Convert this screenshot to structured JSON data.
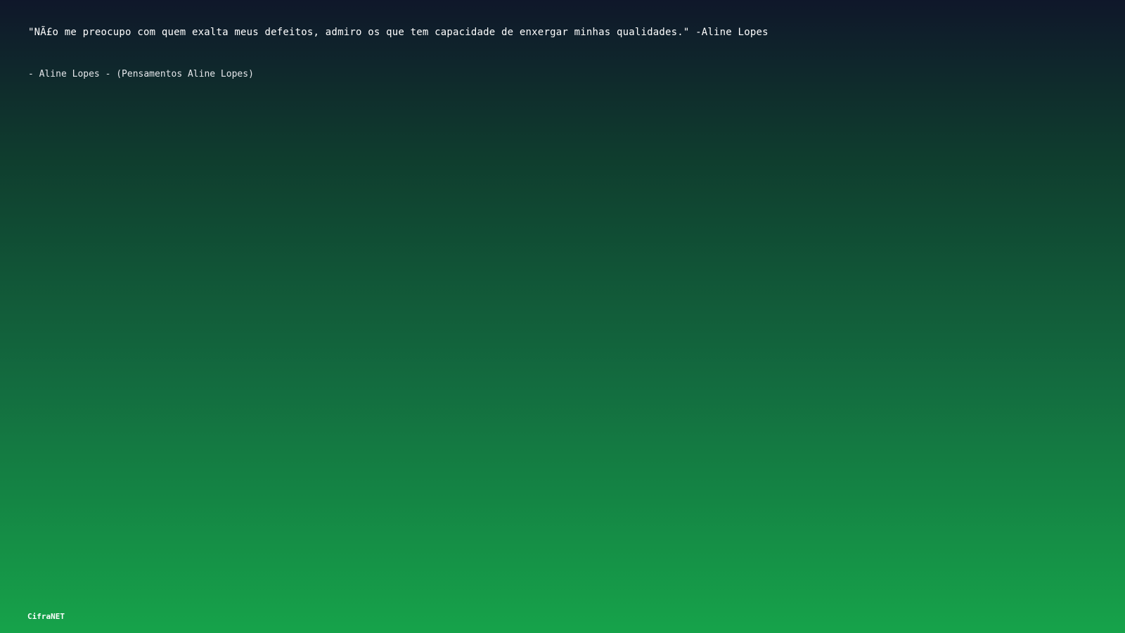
{
  "quote": {
    "text": "\"NÃ£o me preocupo com quem exalta meus defeitos, admiro os que tem capacidade de enxergar minhas qualidades.\" -Aline Lopes"
  },
  "attribution": {
    "text": "- Aline Lopes - (Pensamentos Aline Lopes)"
  },
  "brand": {
    "name": "CifraNET"
  },
  "colors": {
    "gradient_top": "#0f172a",
    "gradient_bottom": "#16a34a",
    "text": "#ffffff"
  }
}
